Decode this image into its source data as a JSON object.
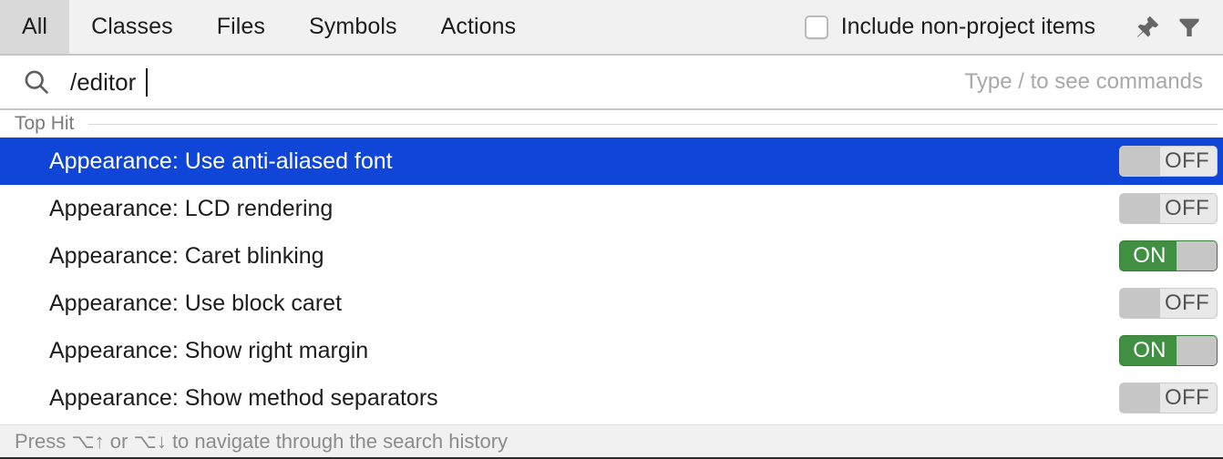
{
  "tabs": [
    {
      "label": "All",
      "selected": true
    },
    {
      "label": "Classes",
      "selected": false
    },
    {
      "label": "Files",
      "selected": false
    },
    {
      "label": "Symbols",
      "selected": false
    },
    {
      "label": "Actions",
      "selected": false
    }
  ],
  "toolbar": {
    "include_non_project_label": "Include non-project items",
    "include_non_project_checked": false,
    "pin_icon": "pin-icon",
    "filter_icon": "filter-funnel-icon"
  },
  "search": {
    "icon": "search-icon",
    "value": "/editor ",
    "hint": "Type / to see commands"
  },
  "group": {
    "title": "Top Hit"
  },
  "results": [
    {
      "label": "Appearance: Use anti-aliased font",
      "toggle": "OFF",
      "state": "off",
      "selected": true
    },
    {
      "label": "Appearance: LCD rendering",
      "toggle": "OFF",
      "state": "off",
      "selected": false
    },
    {
      "label": "Appearance: Caret blinking",
      "toggle": "ON",
      "state": "on",
      "selected": false
    },
    {
      "label": "Appearance: Use block caret",
      "toggle": "OFF",
      "state": "off",
      "selected": false
    },
    {
      "label": "Appearance: Show right margin",
      "toggle": "ON",
      "state": "on",
      "selected": false
    },
    {
      "label": "Appearance: Show method separators",
      "toggle": "OFF",
      "state": "off",
      "selected": false
    }
  ],
  "footer": {
    "hint": "Press ⌥↑ or ⌥↓ to navigate through the search history"
  },
  "colors": {
    "selection_blue": "#1046d8",
    "toggle_on_green": "#418f42",
    "toggle_off_track": "#e8e8e8",
    "toggle_knob": "#c6c6c6",
    "tabbar_bg": "#f1f1f1",
    "tab_selected_bg": "#d9d9d9"
  }
}
